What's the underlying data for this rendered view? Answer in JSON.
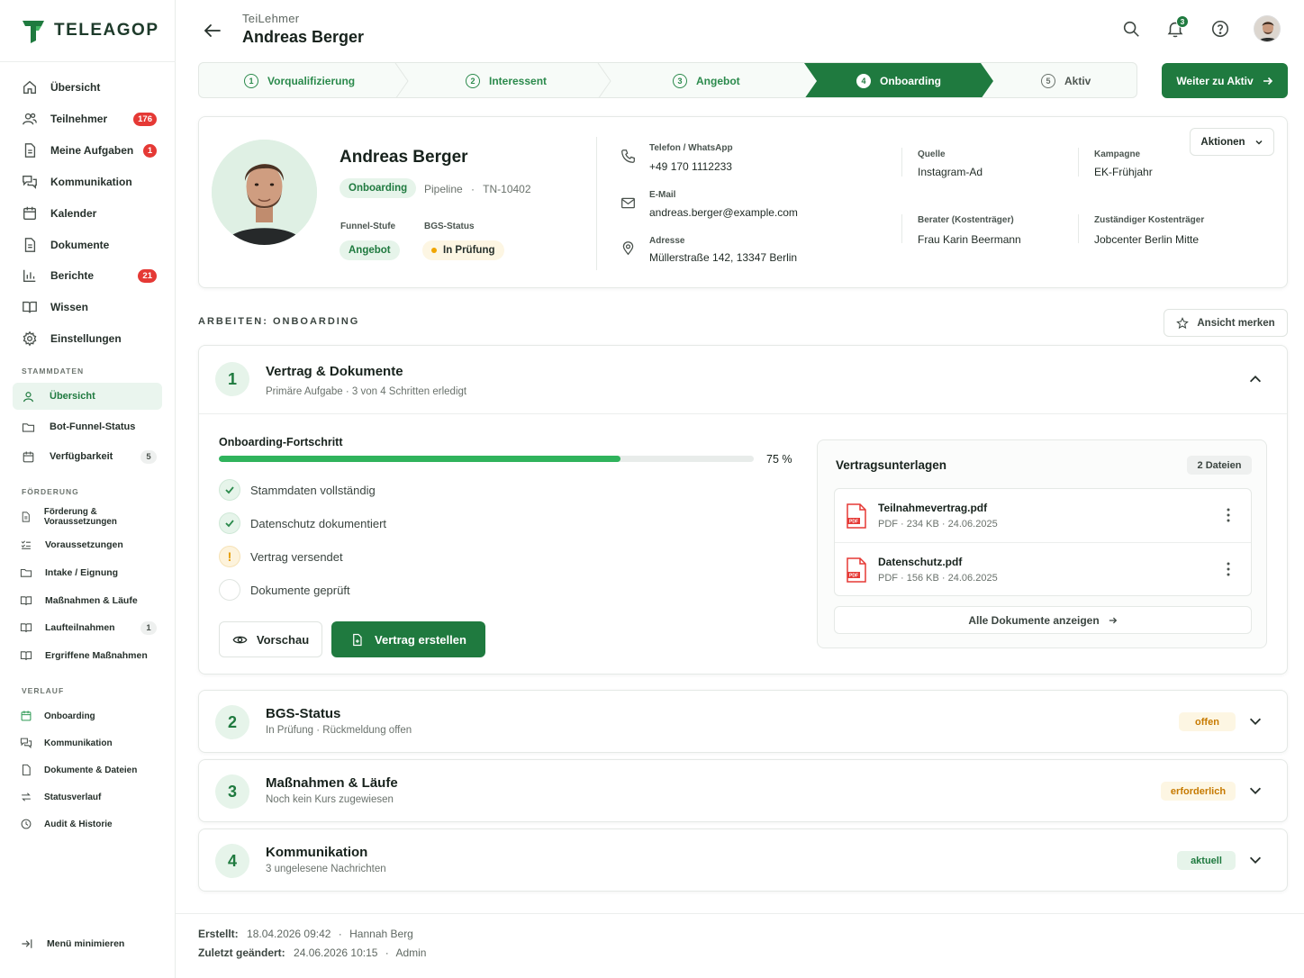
{
  "brand": {
    "name": "TELEAGOP",
    "color": "#1f7a3f"
  },
  "sidebar": {
    "main": [
      {
        "label": "Übersicht",
        "icon": "home-icon"
      },
      {
        "label": "Teilnehmer",
        "icon": "users-icon",
        "badge": "176"
      },
      {
        "label": "Meine Aufgaben",
        "icon": "tasks-icon",
        "badge": "1"
      },
      {
        "label": "Kommunikation",
        "icon": "chat-icon"
      },
      {
        "label": "Kalender",
        "icon": "calendar-icon"
      },
      {
        "label": "Dokumente",
        "icon": "document-icon"
      },
      {
        "label": "Berichte",
        "icon": "chart-icon",
        "badge": "21"
      },
      {
        "label": "Wissen",
        "icon": "book-icon"
      },
      {
        "label": "Einstellungen",
        "icon": "gear-icon"
      }
    ],
    "stammdaten_title": "STAMMDATEN",
    "stammdaten": [
      {
        "label": "Übersicht",
        "icon": "user-icon",
        "active": true
      },
      {
        "label": "Bot-Funnel-Status",
        "icon": "folder-icon"
      },
      {
        "label": "Verfügbarkeit",
        "icon": "calendar-icon",
        "badge": "5"
      }
    ],
    "foerderung_title": "FÖRDERUNG",
    "foerderung": [
      {
        "label": "Förderung & Voraussetzungen",
        "icon": "document-icon"
      },
      {
        "label": "Voraussetzungen",
        "icon": "checklist-icon"
      },
      {
        "label": "Intake / Eignung",
        "icon": "folder-icon"
      },
      {
        "label": "Maßnahmen & Läufe",
        "icon": "book-icon"
      },
      {
        "label": "Laufteilnahmen",
        "icon": "book-icon",
        "badge": "1"
      },
      {
        "label": "Ergriffene Maßnahmen",
        "icon": "book-icon"
      }
    ],
    "verlauf_title": "VERLAUF",
    "verlauf": [
      {
        "label": "Onboarding",
        "icon": "calendar-icon"
      },
      {
        "label": "Kommunikation",
        "icon": "chat-icon"
      },
      {
        "label": "Dokumente & Dateien",
        "icon": "document-icon"
      },
      {
        "label": "Statusverlauf",
        "icon": "swap-icon"
      },
      {
        "label": "Audit & Historie",
        "icon": "clock-icon"
      }
    ],
    "minimize_label": "Menü minimieren"
  },
  "header": {
    "breadcrumb": "TeiLehmer",
    "title": "Andreas Berger",
    "notification_count": "3"
  },
  "stepper": {
    "steps": [
      {
        "num": "1",
        "label": "Vorqualifizierung",
        "state": "done"
      },
      {
        "num": "2",
        "label": "Interessent",
        "state": "done"
      },
      {
        "num": "3",
        "label": "Angebot",
        "state": "done"
      },
      {
        "num": "4",
        "label": "Onboarding",
        "state": "active"
      },
      {
        "num": "5",
        "label": "Aktiv",
        "state": "todo"
      }
    ],
    "next_button": "Weiter zu Aktiv"
  },
  "profile": {
    "name": "Andreas Berger",
    "status": "Onboarding",
    "pipeline_label": "Pipeline",
    "id": "TN-10402",
    "funnel_label": "Funnel-Stufe",
    "funnel_value": "Angebot",
    "bgs_label": "BGS-Status",
    "bgs_value": "In Prüfung",
    "phone_label": "Telefon / WhatsApp",
    "phone": "+49 170 1112233",
    "email_label": "E-Mail",
    "email": "andreas.berger@example.com",
    "address_label": "Adresse",
    "address": "Müllerstraße 142, 13347 Berlin",
    "source_label": "Quelle",
    "source": "Instagram-Ad",
    "campaign_label": "Kampagne",
    "campaign": "EK-Frühjahr",
    "advisor_label": "Berater (Kostenträger)",
    "advisor": "Frau Karin Beermann",
    "payer_label": "Zuständiger Kostenträger",
    "payer": "Jobcenter Berlin Mitte",
    "actions_label": "Aktionen"
  },
  "section": {
    "title": "ARBEITEN: ONBOARDING",
    "save_view": "Ansicht merken"
  },
  "task1": {
    "num": "1",
    "title": "Vertrag & Dokumente",
    "subtitle": "Primäre Aufgabe · 3 von 4 Schritten erledigt",
    "progress_label": "Onboarding-Fortschritt",
    "progress": 75,
    "progress_text": "75 %",
    "checks": [
      {
        "label": "Stammdaten vollständig",
        "state": "done"
      },
      {
        "label": "Datenschutz dokumentiert",
        "state": "done"
      },
      {
        "label": "Vertrag versendet",
        "state": "warn"
      },
      {
        "label": "Dokumente geprüft",
        "state": "todo"
      }
    ],
    "preview_button": "Vorschau",
    "create_button": "Vertrag erstellen",
    "docs": {
      "title": "Vertragsunterlagen",
      "count": "2 Dateien",
      "files": [
        {
          "name": "Teilnahmevertrag.pdf",
          "meta": "PDF · 234 KB · 24.06.2025",
          "type_label": "PDF"
        },
        {
          "name": "Datenschutz.pdf",
          "meta": "PDF · 156 KB · 24.06.2025",
          "type_label": "PDF"
        }
      ],
      "all_label": "Alle Dokumente anzeigen"
    }
  },
  "tasks": [
    {
      "num": "2",
      "title": "BGS-Status",
      "subtitle": "In Prüfung · Rückmeldung offen",
      "tag": "offen",
      "tag_type": "warn"
    },
    {
      "num": "3",
      "title": "Maßnahmen & Läufe",
      "subtitle": "Noch kein Kurs zugewiesen",
      "tag": "erforderlich",
      "tag_type": "warn"
    },
    {
      "num": "4",
      "title": "Kommunikation",
      "subtitle": "3 ungelesene Nachrichten",
      "tag": "aktuell",
      "tag_type": "ok"
    }
  ],
  "footer": {
    "created_label": "Erstellt:",
    "created": "18.04.2026 09:42",
    "created_by": "Hannah Berg",
    "changed_label": "Zuletzt geändert:",
    "changed": "24.06.2026 10:15",
    "changed_by": "Admin"
  }
}
